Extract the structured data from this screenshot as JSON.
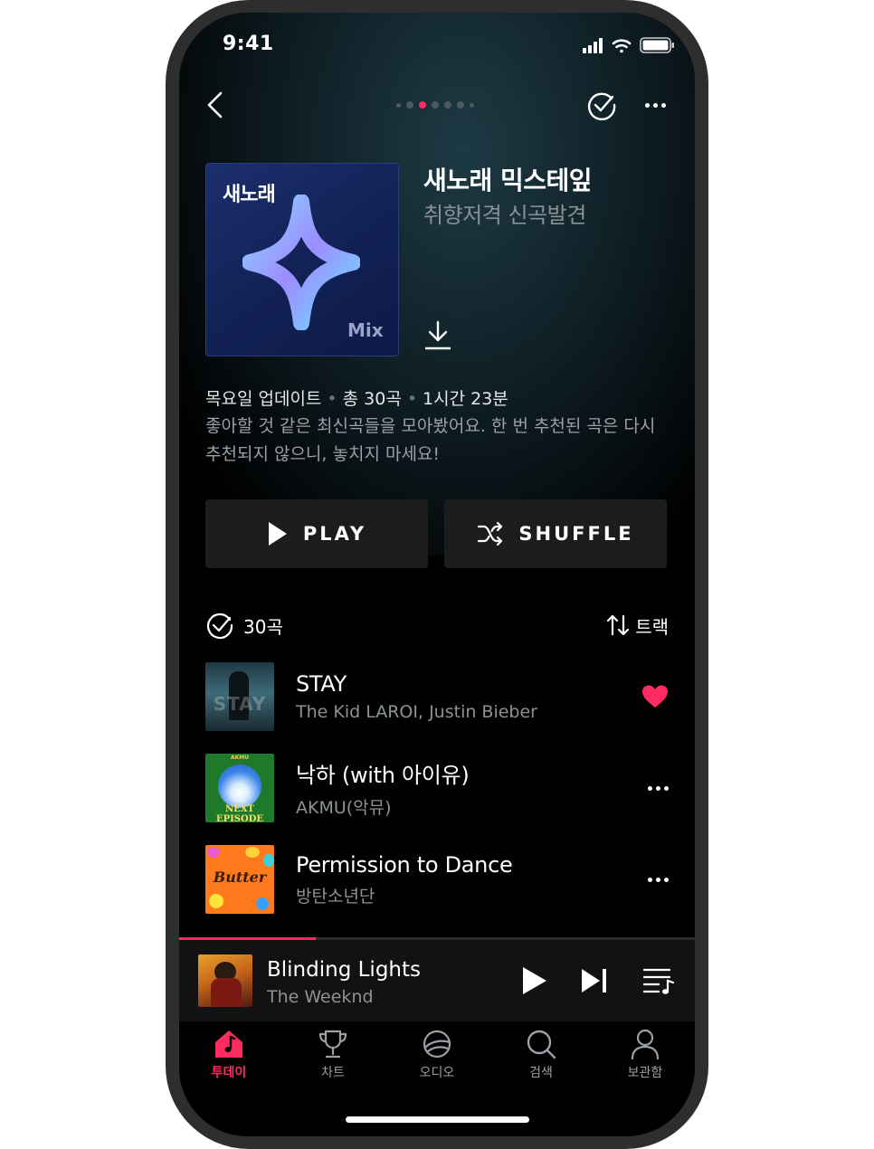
{
  "status_bar": {
    "time": "9:41"
  },
  "header": {
    "page_dots_count": 6,
    "active_dot_index": 1
  },
  "playlist": {
    "cover_title": "새노래",
    "cover_badge": "Mix",
    "title": "새노래 믹스테잎",
    "subtitle": "취향저격 신곡발견",
    "meta": {
      "updated": "목요일 업데이트",
      "total": "총 30곡",
      "duration": "1시간 23분"
    },
    "description": "좋아할 것 같은 최신곡들을 모아봤어요. 한 번 추천된 곡은 다시 추천되지 않으니, 놓치지 마세요!",
    "play_label": "PLAY",
    "shuffle_label": "SHUFFLE",
    "count_label": "30곡",
    "sort_label": "트랙"
  },
  "tracks": [
    {
      "title": "STAY",
      "artist": "The Kid LAROI, Justin Bieber",
      "liked": true,
      "art_text": "STAY"
    },
    {
      "title": "낙하 (with 아이유)",
      "artist": "AKMU(악뮤)",
      "liked": false,
      "art_text": "NEXT EPISODE",
      "art_top": "AKMU"
    },
    {
      "title": "Permission to Dance",
      "artist": "방탄소년단",
      "liked": false,
      "art_text": "Butter"
    }
  ],
  "mini_player": {
    "title": "Blinding Lights",
    "artist": "The Weeknd",
    "progress": 0.265
  },
  "tabs": [
    {
      "label": "투데이",
      "active": true
    },
    {
      "label": "차트",
      "active": false
    },
    {
      "label": "오디오",
      "active": false
    },
    {
      "label": "검색",
      "active": false
    },
    {
      "label": "보관함",
      "active": false
    }
  ],
  "colors": {
    "accent": "#ff2a5f",
    "background": "#000000",
    "button_bg": "#1c1c1c"
  }
}
